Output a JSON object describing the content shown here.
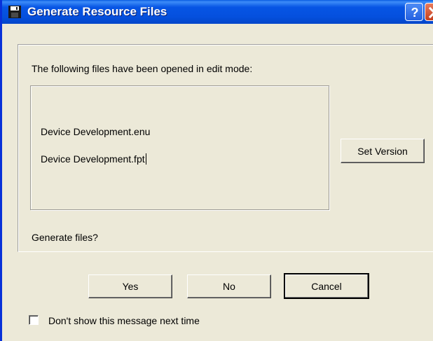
{
  "window": {
    "title": "Generate Resource Files",
    "icons": {
      "app": "floppy-disk-icon",
      "help": "question-mark-icon",
      "close": "close-x-icon"
    },
    "colors": {
      "titlebar": "#0755e4",
      "window_bg": "#ece9d8",
      "close_button": "#d9512f"
    }
  },
  "content": {
    "intro": "The following files have been opened in edit mode:",
    "files": [
      "Device Development.enu",
      "Device Development.fpt"
    ],
    "question": "Generate files?"
  },
  "buttons": {
    "set_version": "Set Version",
    "yes": "Yes",
    "no": "No",
    "cancel": "Cancel"
  },
  "checkbox": {
    "label": "Don't show this message next time",
    "checked": false
  }
}
